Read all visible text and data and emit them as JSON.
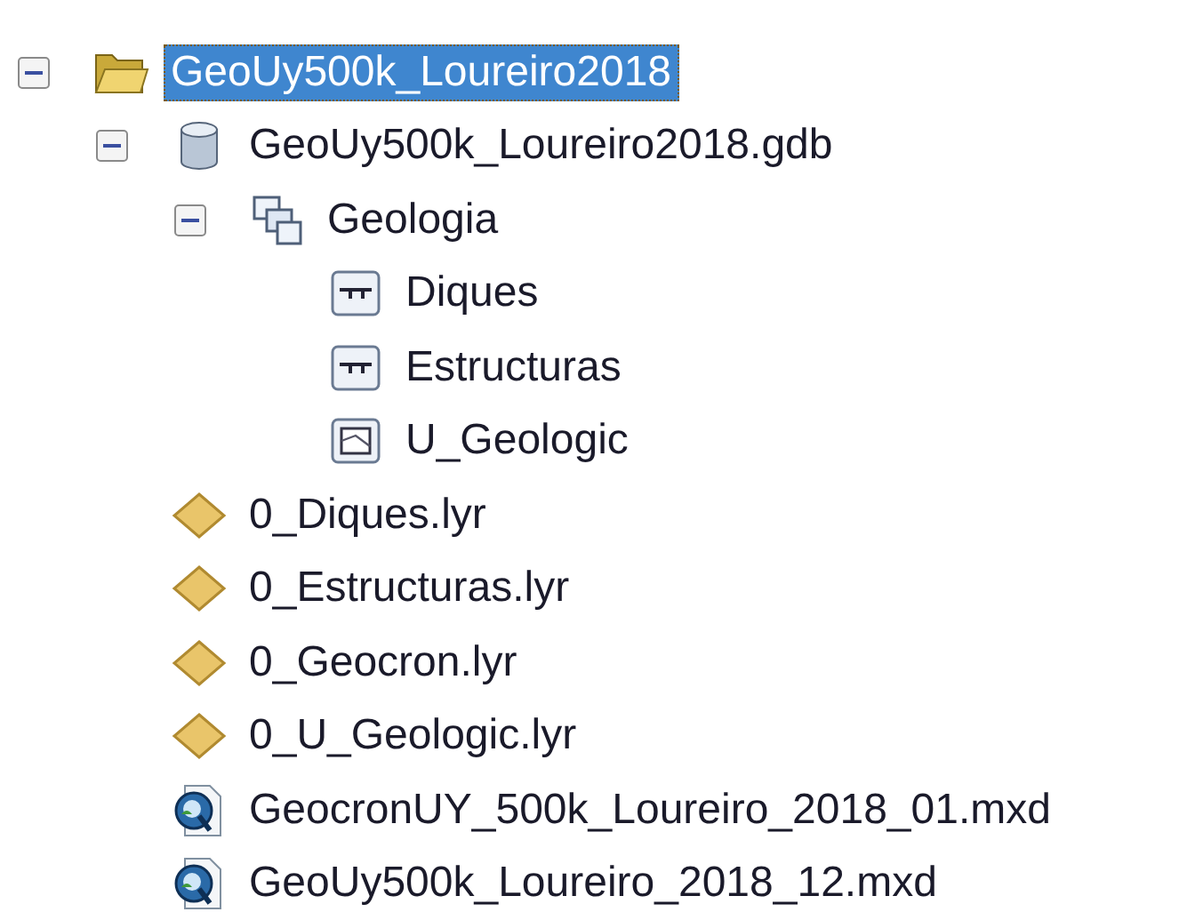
{
  "tree": [
    {
      "kind": "folder",
      "label": "GeoUy500k_Loureiro2018",
      "selected": true,
      "expanded": true,
      "children": [
        {
          "kind": "gdb",
          "label": "GeoUy500k_Loureiro2018.gdb",
          "selected": false,
          "expanded": true,
          "children": [
            {
              "kind": "dataset",
              "label": "Geologia",
              "selected": false,
              "expanded": true,
              "children": [
                {
                  "kind": "line",
                  "label": "Diques",
                  "selected": false
                },
                {
                  "kind": "line",
                  "label": "Estructuras",
                  "selected": false
                },
                {
                  "kind": "polygon",
                  "label": "U_Geologic",
                  "selected": false
                }
              ]
            }
          ]
        },
        {
          "kind": "layer",
          "label": "0_Diques.lyr",
          "selected": false
        },
        {
          "kind": "layer",
          "label": "0_Estructuras.lyr",
          "selected": false
        },
        {
          "kind": "layer",
          "label": "0_Geocron.lyr",
          "selected": false
        },
        {
          "kind": "layer",
          "label": "0_U_Geologic.lyr",
          "selected": false
        },
        {
          "kind": "mxd",
          "label": "GeocronUY_500k_Loureiro_2018_01.mxd",
          "selected": false
        },
        {
          "kind": "mxd",
          "label": "GeoUy500k_Loureiro_2018_12.mxd",
          "selected": false
        }
      ]
    }
  ]
}
